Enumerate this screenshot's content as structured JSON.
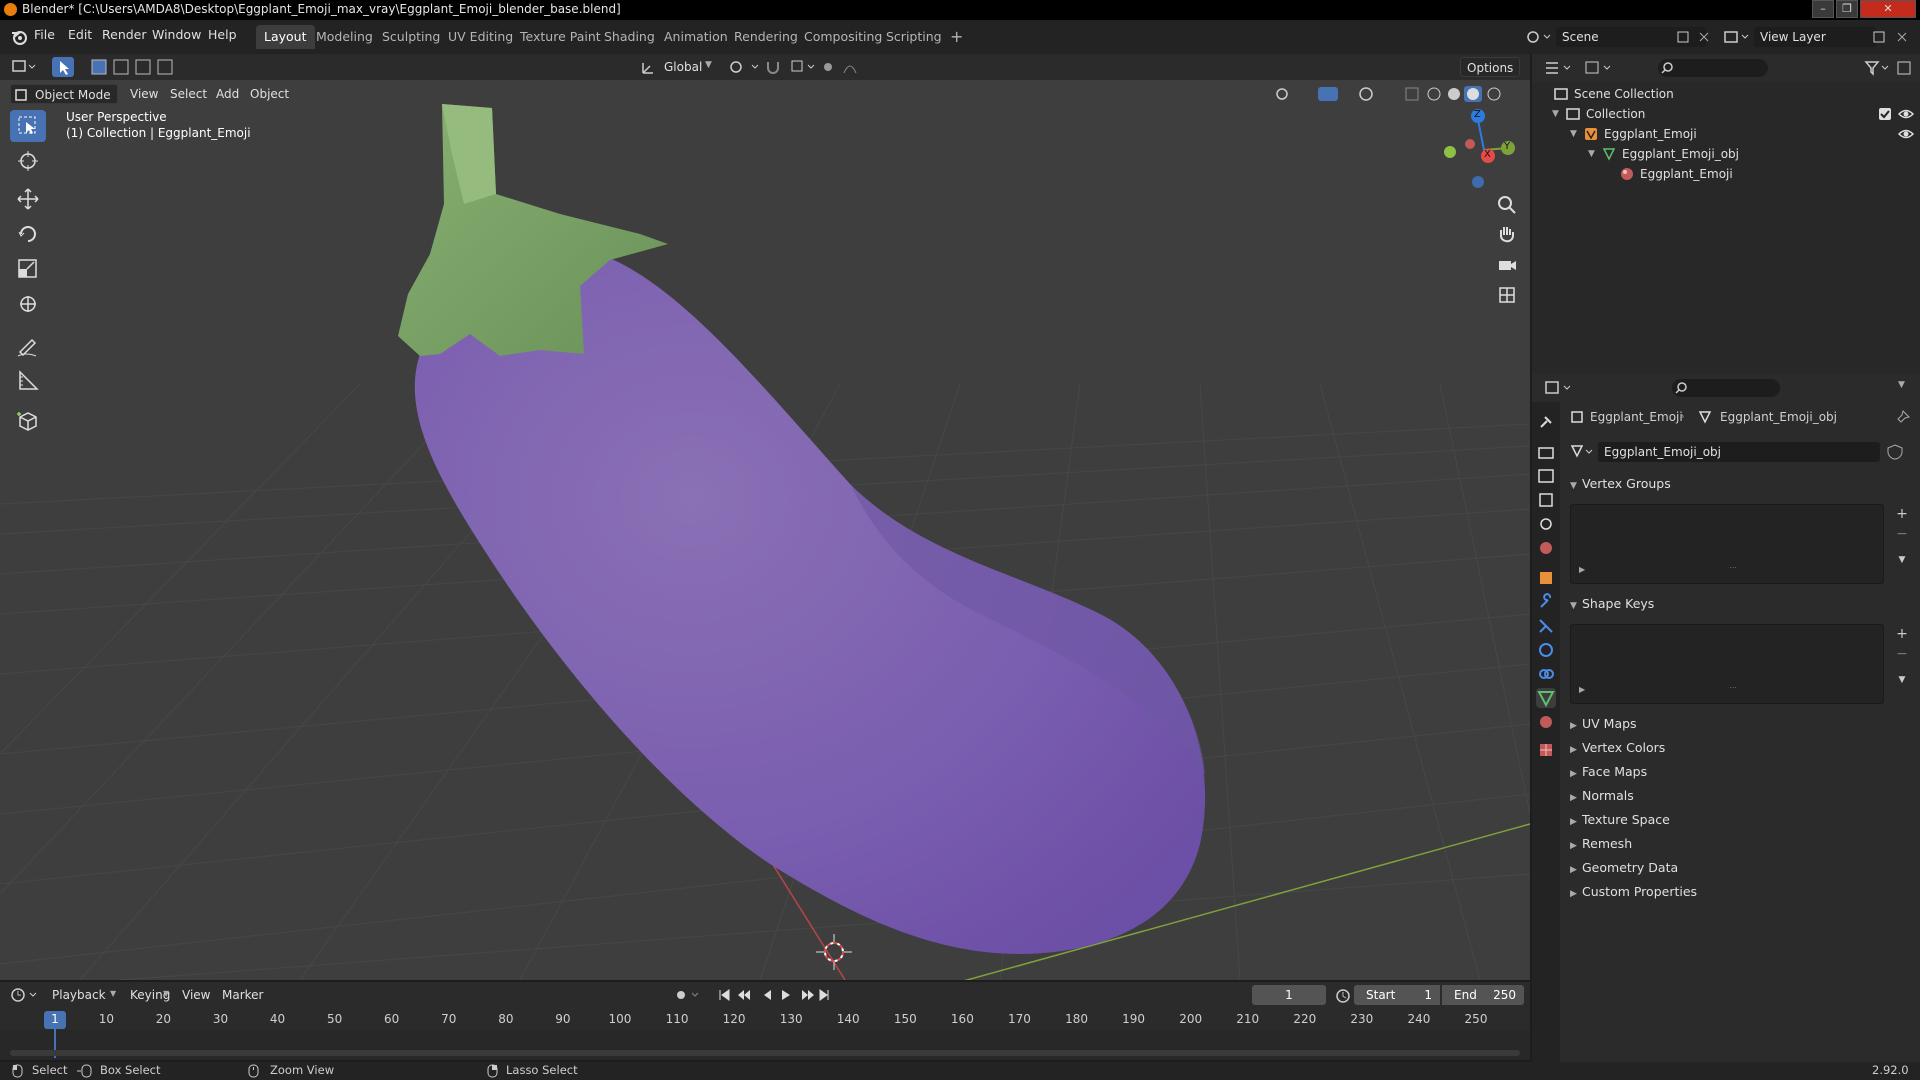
{
  "window": {
    "title": "Blender* [C:\\Users\\AMDA8\\Desktop\\Eggplant_Emoji_max_vray\\Eggplant_Emoji_blender_base.blend]"
  },
  "menu": {
    "items": [
      "File",
      "Edit",
      "Render",
      "Window",
      "Help"
    ]
  },
  "workspaces": {
    "tabs": [
      "Layout",
      "Modeling",
      "Sculpting",
      "UV Editing",
      "Texture Paint",
      "Shading",
      "Animation",
      "Rendering",
      "Compositing",
      "Scripting"
    ],
    "active": "Layout",
    "add": "+"
  },
  "scene": {
    "name": "Scene",
    "view_layer": "View Layer"
  },
  "tool_header": {
    "orientation": "Global",
    "options": "Options"
  },
  "view_header": {
    "mode": "Object Mode",
    "menus": [
      "View",
      "Select",
      "Add",
      "Object"
    ]
  },
  "viewport": {
    "perspective": "User Perspective",
    "collection_info": "(1) Collection | Eggplant_Emoji",
    "axis_labels": {
      "z": "Z",
      "y": "Y",
      "x": "X"
    },
    "colors": {
      "eggplant": "#7b5fae",
      "stem": "#7ea36b",
      "grid": "#4a4a4a",
      "x_axis": "#b94646",
      "y_axis": "#7ea23a"
    }
  },
  "outliner": {
    "rows": [
      {
        "label": "Scene Collection"
      },
      {
        "label": "Collection"
      },
      {
        "label": "Eggplant_Emoji"
      },
      {
        "label": "Eggplant_Emoji_obj"
      },
      {
        "label": "Eggplant_Emoji"
      }
    ]
  },
  "properties": {
    "breadcrumb_object": "Eggplant_Emoji",
    "breadcrumb_mesh": "Eggplant_Emoji_obj",
    "mesh_name": "Eggplant_Emoji_obj",
    "open_panels": [
      "Vertex Groups",
      "Shape Keys"
    ],
    "closed_panels": [
      "UV Maps",
      "Vertex Colors",
      "Face Maps",
      "Normals",
      "Texture Space",
      "Remesh",
      "Geometry Data",
      "Custom Properties"
    ]
  },
  "timeline": {
    "menus": [
      "Playback",
      "Keying",
      "View",
      "Marker"
    ],
    "current_frame": "1",
    "start_label": "Start",
    "start": "1",
    "end_label": "End",
    "end": "250",
    "ticks": [
      "1",
      "10",
      "20",
      "30",
      "40",
      "50",
      "60",
      "70",
      "80",
      "90",
      "100",
      "110",
      "120",
      "130",
      "140",
      "150",
      "160",
      "170",
      "180",
      "190",
      "200",
      "210",
      "220",
      "230",
      "240",
      "250"
    ]
  },
  "statusbar": {
    "select": "Select",
    "box_select": "Box Select",
    "zoom_view": "Zoom View",
    "lasso_select": "Lasso Select",
    "version": "2.92.0"
  }
}
